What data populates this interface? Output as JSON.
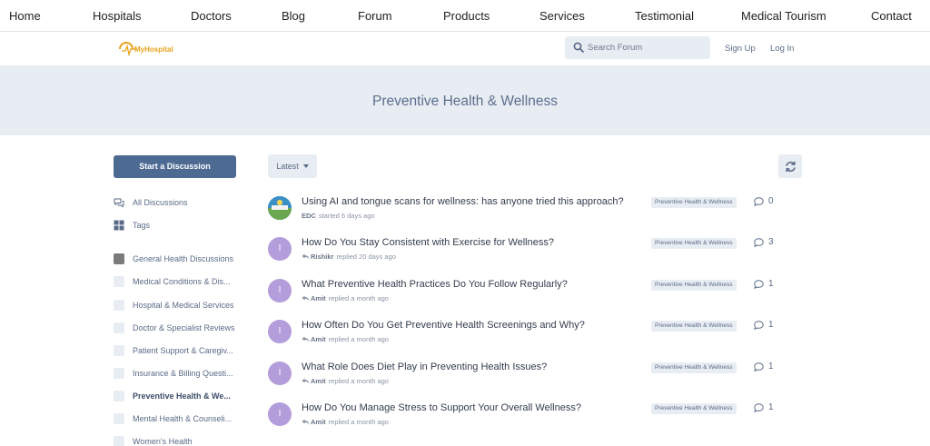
{
  "site_nav": {
    "items": [
      "Home",
      "Hospitals",
      "Doctors",
      "Blog",
      "Forum",
      "Products",
      "Services",
      "Testimonial",
      "Medical Tourism",
      "Contact"
    ]
  },
  "header": {
    "logo_text": "MyHospital",
    "search_placeholder": "Search Forum",
    "sign_up": "Sign Up",
    "log_in": "Log In"
  },
  "hero": {
    "title": "Preventive Health & Wellness"
  },
  "sidebar": {
    "start_button": "Start a Discussion",
    "all_discussions": "All Discussions",
    "tags": "Tags",
    "categories": [
      "General Health Discussions",
      "Medical Conditions & Dis...",
      "Hospital & Medical Services",
      "Doctor & Specialist Reviews",
      "Patient Support & Caregiv...",
      "Insurance & Billing Questi...",
      "Preventive Health & We...",
      "Mental Health & Counseli...",
      "Women's Health"
    ]
  },
  "toolbar": {
    "sort_label": "Latest"
  },
  "discussions": [
    {
      "title": "Using AI and tongue scans for wellness: has anyone tried this approach?",
      "user": "EDC",
      "action": "started 6 days ago",
      "tag": "Preventive Health & Wellness",
      "count": "0",
      "avatar": ""
    },
    {
      "title": "How Do You Stay Consistent with Exercise for Wellness?",
      "user": "Rishikr",
      "action": "replied 20 days ago",
      "tag": "Preventive Health & Wellness",
      "count": "3",
      "avatar": "I"
    },
    {
      "title": "What Preventive Health Practices Do You Follow Regularly?",
      "user": "Amit",
      "action": "replied a month ago",
      "tag": "Preventive Health & Wellness",
      "count": "1",
      "avatar": "I"
    },
    {
      "title": "How Often Do You Get Preventive Health Screenings and Why?",
      "user": "Amit",
      "action": "replied a month ago",
      "tag": "Preventive Health & Wellness",
      "count": "1",
      "avatar": "I"
    },
    {
      "title": "What Role Does Diet Play in Preventing Health Issues?",
      "user": "Amit",
      "action": "replied a month ago",
      "tag": "Preventive Health & Wellness",
      "count": "1",
      "avatar": "I"
    },
    {
      "title": "How Do You Manage Stress to Support Your Overall Wellness?",
      "user": "Amit",
      "action": "replied a month ago",
      "tag": "Preventive Health & Wellness",
      "count": "1",
      "avatar": "I"
    }
  ],
  "colors": {
    "accent": "#4c6a92",
    "surface": "#e8ecf3",
    "avatar": "#b39ddb",
    "logo": "#e8a21a"
  }
}
